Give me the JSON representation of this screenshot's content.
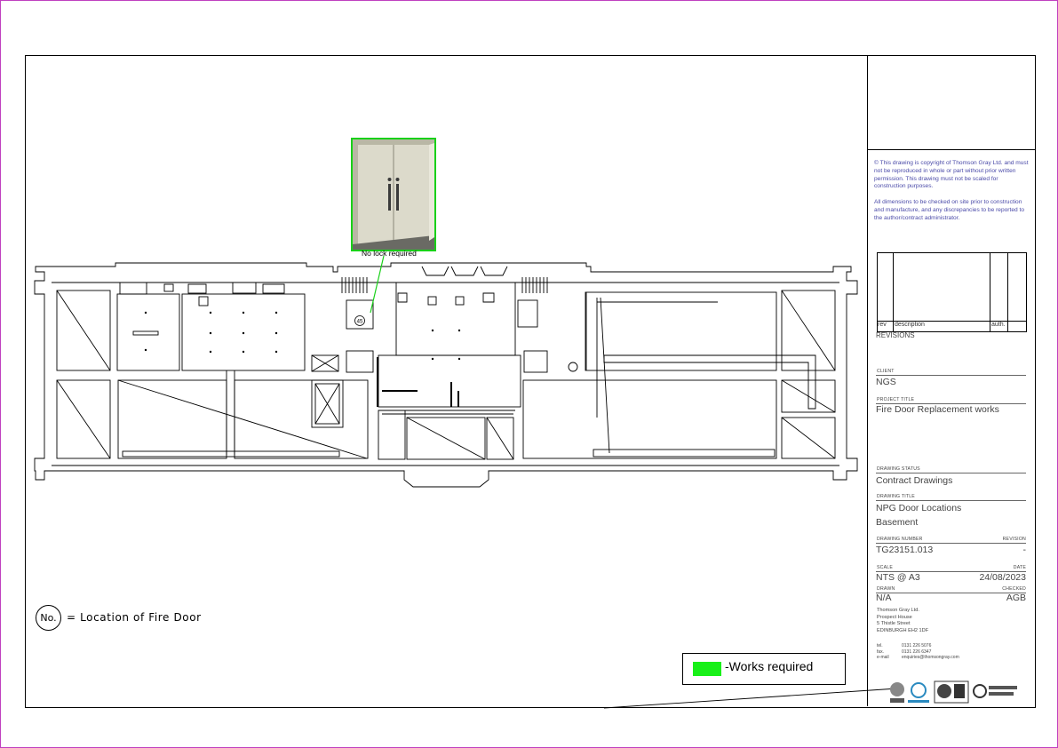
{
  "notes": {
    "copyright": "© This drawing is copyright of Thomson Gray Ltd. and must not be reproduced in whole or part without prior written permission. This drawing must not be scaled for construction purposes.",
    "dimensions": "All dimensions to be checked on site prior to construction and manufacture, and any discrepancies to be reported to the author/contract administrator."
  },
  "revisions": {
    "col_rev": "rev",
    "col_description": "description",
    "col_auth": "auth.",
    "title": "REVISIONS"
  },
  "client": {
    "label": "CLIENT",
    "value": "NGS"
  },
  "project": {
    "label": "PROJECT TITLE",
    "value": "Fire Door Replacement works"
  },
  "status": {
    "label": "DRAWING STATUS",
    "value": "Contract Drawings"
  },
  "drawing_title": {
    "label": "DRAWING TITLE",
    "line1": "NPG Door Locations",
    "line2": "Basement"
  },
  "drawing_number": {
    "label": "DRAWING NUMBER",
    "value": "TG23151.013",
    "rev_label": "REVISION",
    "rev_value": "-"
  },
  "scale": {
    "label": "SCALE",
    "value": "NTS @ A3",
    "date_label": "DATE",
    "date_value": "24/08/2023"
  },
  "drawn": {
    "label": "DRAWN",
    "value": "N/A",
    "checked_label": "CHECKED",
    "checked_value": "AGB"
  },
  "address": {
    "company": "Thomson Gray Ltd.",
    "line1": "Prospect House",
    "line2": "5 Thistle Street",
    "line3": "EDINBURGH EH2 1DF",
    "tel_label": "tel.",
    "tel": "0131 226 5076",
    "fax_label": "fax.",
    "fax": "0131 226 6347",
    "email_label": "e-mail",
    "email": "enquiries@thomsongray.com"
  },
  "legend": {
    "works_required": "-Works required",
    "swatch_color": "#19f019"
  },
  "key": {
    "symbol": "No.",
    "text": "= Location of Fire Door"
  },
  "photo": {
    "caption": "No lock required"
  },
  "door_marker": {
    "number": "45"
  },
  "colors": {
    "accent_green": "#19d019",
    "frame_magenta": "#c040c0",
    "note_blue": "#4a4aa8"
  }
}
